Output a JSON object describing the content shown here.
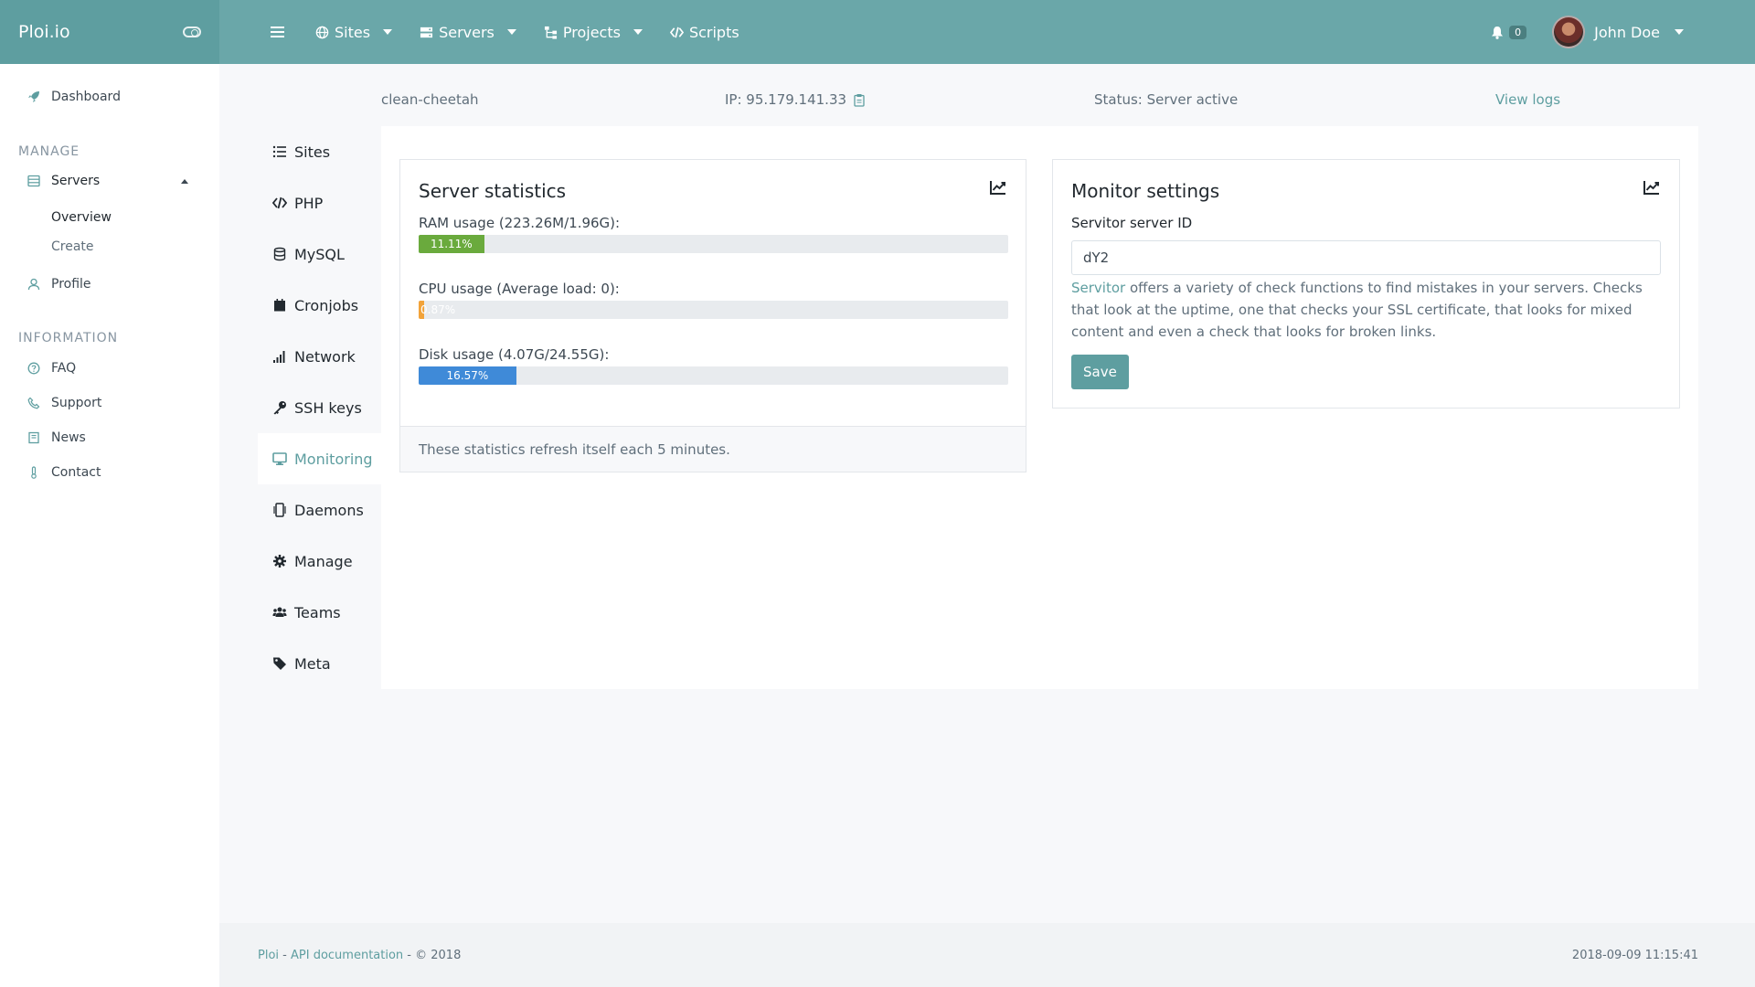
{
  "app": {
    "brand": "Ploi.io"
  },
  "topnav": {
    "items": [
      {
        "label": "Sites",
        "icon": "globe-icon",
        "has_caret": true
      },
      {
        "label": "Servers",
        "icon": "server-icon",
        "has_caret": true
      },
      {
        "label": "Projects",
        "icon": "sitemap-icon",
        "has_caret": true
      },
      {
        "label": "Scripts",
        "icon": "code-icon",
        "has_caret": false
      }
    ],
    "notifications_count": "0",
    "user_name": "John Doe"
  },
  "sidebar": {
    "dashboard": "Dashboard",
    "manage_heading": "MANAGE",
    "servers": "Servers",
    "servers_sub": [
      "Overview",
      "Create"
    ],
    "profile": "Profile",
    "information_heading": "INFORMATION",
    "info_items": [
      "FAQ",
      "Support",
      "News",
      "Contact"
    ]
  },
  "server": {
    "name": "clean-cheetah",
    "ip": "IP: 95.179.141.33",
    "status": "Status: Server active",
    "view_logs": "View logs"
  },
  "tabs": [
    "Sites",
    "PHP",
    "MySQL",
    "Cronjobs",
    "Network",
    "SSH keys",
    "Monitoring",
    "Daemons",
    "Manage",
    "Teams",
    "Meta"
  ],
  "active_tab": "Monitoring",
  "stats": {
    "title": "Server statistics",
    "ram_label": "RAM usage (223.26M/1.96G):",
    "ram_percent_text": "11.11%",
    "ram_percent": 11.11,
    "cpu_label": "CPU usage (Average load: 0):",
    "cpu_percent_text": "0.87%",
    "cpu_percent": 0.87,
    "disk_label": "Disk usage (4.07G/24.55G):",
    "disk_percent_text": "16.57%",
    "disk_percent": 16.57,
    "footer": "These statistics refresh itself each 5 minutes.",
    "colors": {
      "ram": "#6aaa3d",
      "cpu": "#f2a33a",
      "disk": "#3f8ad8"
    }
  },
  "monitor": {
    "title": "Monitor settings",
    "field_label": "Servitor server ID",
    "field_value": "dY2",
    "help_link": "Servitor",
    "help_text": " offers a variety of check functions to find mistakes in your servers. Checks that look at the uptime, one that checks your SSL certificate, that looks for mixed content and even a check that looks for broken links.",
    "save": "Save"
  },
  "footer": {
    "ploi": "Ploi",
    "sep1": " - ",
    "api": "API documentation",
    "copy": " - © 2018",
    "timestamp": "2018-09-09 11:15:41"
  }
}
